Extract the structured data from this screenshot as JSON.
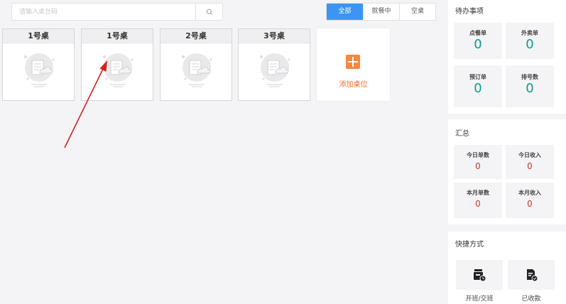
{
  "search": {
    "placeholder": "请输入桌台码"
  },
  "filters": [
    {
      "label": "全部",
      "active": true
    },
    {
      "label": "就餐中",
      "active": false
    },
    {
      "label": "空桌",
      "active": false
    }
  ],
  "tables": [
    {
      "name": "1号桌"
    },
    {
      "name": "1号桌"
    },
    {
      "name": "2号桌"
    },
    {
      "name": "3号桌"
    }
  ],
  "add_table": {
    "label": "添加桌位"
  },
  "todo": {
    "title": "待办事项",
    "items": [
      {
        "label": "点餐单",
        "value": "0"
      },
      {
        "label": "外卖单",
        "value": "0"
      },
      {
        "label": "预订单",
        "value": "0"
      },
      {
        "label": "排号数",
        "value": "0"
      }
    ]
  },
  "summary": {
    "title": "汇总",
    "items": [
      {
        "label": "今日单数",
        "value": "0"
      },
      {
        "label": "今日收入",
        "value": "0"
      },
      {
        "label": "本月单数",
        "value": "0"
      },
      {
        "label": "本月收入",
        "value": "0"
      }
    ]
  },
  "shortcuts": {
    "title": "快捷方式",
    "items": [
      {
        "label": "开班/交班",
        "icon": "shift-handover-icon"
      },
      {
        "label": "已收款",
        "icon": "received-payment-icon"
      }
    ]
  },
  "colors": {
    "accent": "#3d95f3",
    "stat": "#0c9a8e",
    "money": "#c0392b",
    "add": "#f5873f",
    "arrow": "#d2231d"
  }
}
